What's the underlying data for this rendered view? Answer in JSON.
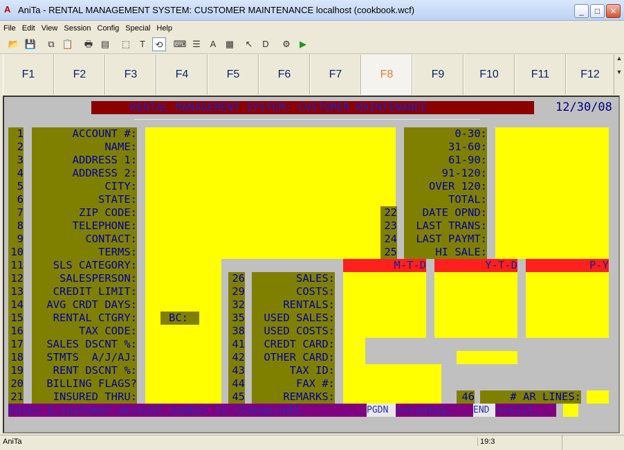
{
  "window": {
    "title": "AniTa - RENTAL MANAGEMENT SYSTEM: CUSTOMER MAINTENANCE  localhost (cookbook.wcf)",
    "app_icon": "A",
    "minimize": "_",
    "maximize": "□",
    "close": "✕"
  },
  "menu": [
    "File",
    "Edit",
    "View",
    "Session",
    "Config",
    "Special",
    "Help"
  ],
  "fkeys": [
    "F1",
    "F2",
    "F3",
    "F4",
    "F5",
    "F6",
    "F7",
    "F8",
    "F9",
    "F10",
    "F11",
    "F12"
  ],
  "screen": {
    "header": "RENTAL MANAGEMENT SYSTEM: CUSTOMER MAINTENANCE",
    "date": "12/30/08",
    "left_numbers": [
      "1",
      "2",
      "3",
      "4",
      "5",
      "6",
      "7",
      "8",
      "9",
      "10",
      "11",
      "12",
      "13",
      "14",
      "15",
      "16",
      "17",
      "18",
      "19",
      "20",
      "21"
    ],
    "left_labels": [
      "ACCOUNT #:",
      "NAME:",
      "ADDRESS 1:",
      "ADDRESS 2:",
      "CITY:",
      "STATE:",
      "ZIP CODE:",
      "TELEPHONE:",
      "CONTACT:",
      "TERMS:",
      "SLS CATEGORY:",
      "SALESPERSON:",
      "CREDIT LIMIT:",
      "AVG CRDT DAYS:",
      "RENTAL CTGRY:",
      "TAX CODE:",
      "SALES DSCNT %:",
      "STMTS  A/J/AJ:",
      "RENT DSCNT %:",
      "BILLING FLAGS?",
      "INSURED THRU:"
    ],
    "bc_label": "BC:",
    "aging_labels": [
      "0-30:",
      "31-60:",
      "61-90:",
      "91-120:",
      "OVER 120:",
      "TOTAL:"
    ],
    "date_numbers": [
      "22",
      "23",
      "24",
      "25"
    ],
    "date_labels": [
      "DATE OPND:",
      "LAST TRANS:",
      "LAST PAYMT:",
      "HI SALE:"
    ],
    "mid_numbers": [
      "26",
      "29",
      "32",
      "35",
      "38",
      "41",
      "42",
      "43",
      "44",
      "45"
    ],
    "mid_labels": [
      "SALES:",
      "COSTS:",
      "RENTALS:",
      "USED SALES:",
      "USED COSTS:",
      "CREDT CARD:",
      "OTHER CARD:",
      "TAX ID:",
      "FAX #:",
      "REMARKS:"
    ],
    "period_headers": [
      "M-T-D",
      "Y-T-D",
      "P-Y"
    ],
    "ar_number": "46",
    "ar_label": "# AR LINES:",
    "prompt": "Enter a customer account number to change/add,",
    "prompt_key1": "PGDN",
    "prompt_mid": ">=lookup,",
    "prompt_key2": "END",
    "prompt_end": ">=exit."
  },
  "status": {
    "app": "AniTa",
    "cursor": "19:3"
  }
}
